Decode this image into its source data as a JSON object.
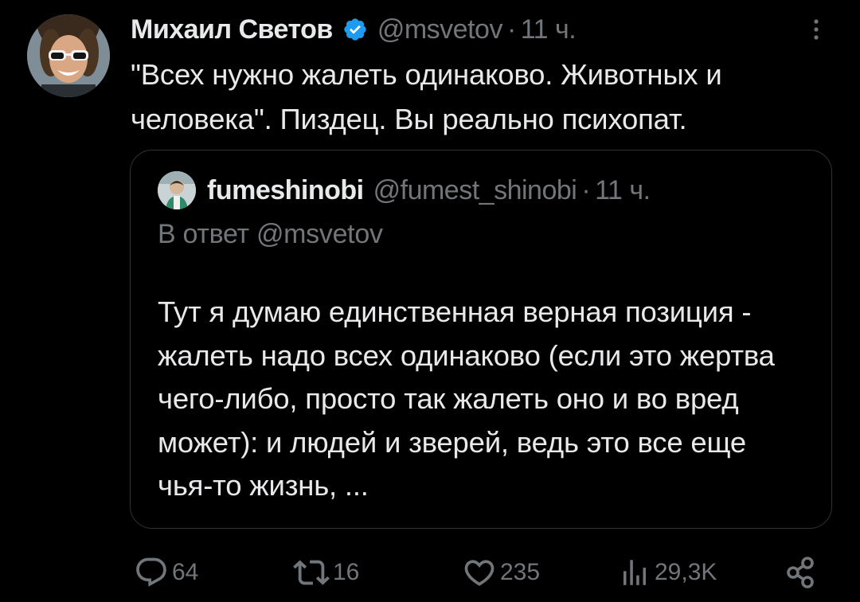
{
  "tweet": {
    "author_name": "Михаил Светов",
    "handle": "@msvetov",
    "separator": "·",
    "time": "11 ч.",
    "text": "\"Всех нужно жалеть одинаково. Животных и человека\". Пиздец. Вы реально психопат."
  },
  "quote": {
    "author_name": "fumeshinobi",
    "handle": "@fumest_shinobi",
    "separator": "·",
    "time": "11 ч.",
    "reply_to": "В ответ @msvetov",
    "text": "Тут я думаю единственная верная позиция - жалеть надо всех одинаково (если это жертва чего-либо, просто так жалеть оно и во вред может): и людей и зверей, ведь это все еще чья-то жизнь, ..."
  },
  "actions": {
    "replies": "64",
    "retweets": "16",
    "likes": "235",
    "views": "29,3K"
  },
  "icons": {
    "verified": "verified-badge-icon",
    "more": "more-vertical-icon",
    "reply": "reply-icon",
    "retweet": "retweet-icon",
    "like": "heart-icon",
    "views": "views-chart-icon",
    "share": "share-icon"
  },
  "colors": {
    "background": "#000000",
    "text": "#e7e9ea",
    "muted": "#71767b",
    "border": "#2f3336",
    "verified": "#1d9bf0"
  }
}
